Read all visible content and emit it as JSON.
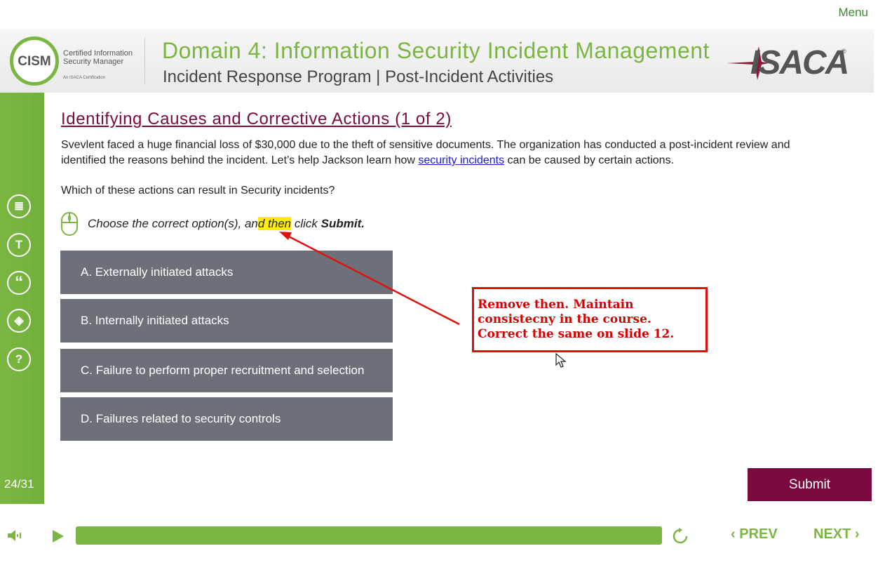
{
  "menu_label": "Menu",
  "header": {
    "cism_abbr": "CISM",
    "cism_line1": "Certified Information",
    "cism_line2": "Security Manager",
    "cism_tagline": "An ISACA Certification",
    "domain_title": "Domain 4: Information Security Incident Management",
    "sub_title": "Incident Response Program | Post-Incident Activities",
    "brand": "ISACA"
  },
  "sidebar": {
    "buttons": [
      {
        "icon": "document-icon",
        "glyph": "≣"
      },
      {
        "icon": "transcript-icon",
        "glyph": "T"
      },
      {
        "icon": "quote-icon",
        "glyph": "“"
      },
      {
        "icon": "layers-icon",
        "glyph": "◈"
      },
      {
        "icon": "help-icon",
        "glyph": "?"
      }
    ],
    "page_number": "24/31"
  },
  "slide": {
    "title": "Identifying Causes and Corrective Actions (1 of 2)",
    "intro_pre": "Svevlent faced a huge financial loss of $30,000 due to the theft of sensitive documents. The organization has conducted a post-incident review and identified the reasons behind the incident. Let’s help Jackson learn how ",
    "intro_link": "security incidents",
    "intro_post": " can be caused by certain actions.",
    "question": "Which of these actions can result in Security incidents?",
    "instruction_pre": "Choose the correct option(s), an",
    "instruction_highlight": "d then",
    "instruction_mid": " click ",
    "instruction_submit": "Submit.",
    "options": [
      "A. Externally initiated attacks",
      "B. Internally initiated attacks",
      "C. Failure to perform proper recruitment and selection",
      "D. Failures related to security controls"
    ],
    "submit_label": "Submit"
  },
  "annotation": {
    "text": "Remove then. Maintain consistecny in the course. Correct the same on slide 12.",
    "color": "#e01010"
  },
  "controls": {
    "progress": 1.0,
    "prev_label": "PREV",
    "next_label": "NEXT"
  },
  "colors": {
    "accent_green": "#7cb642",
    "maroon": "#7b0a3f",
    "option_gray": "#6d7079"
  }
}
